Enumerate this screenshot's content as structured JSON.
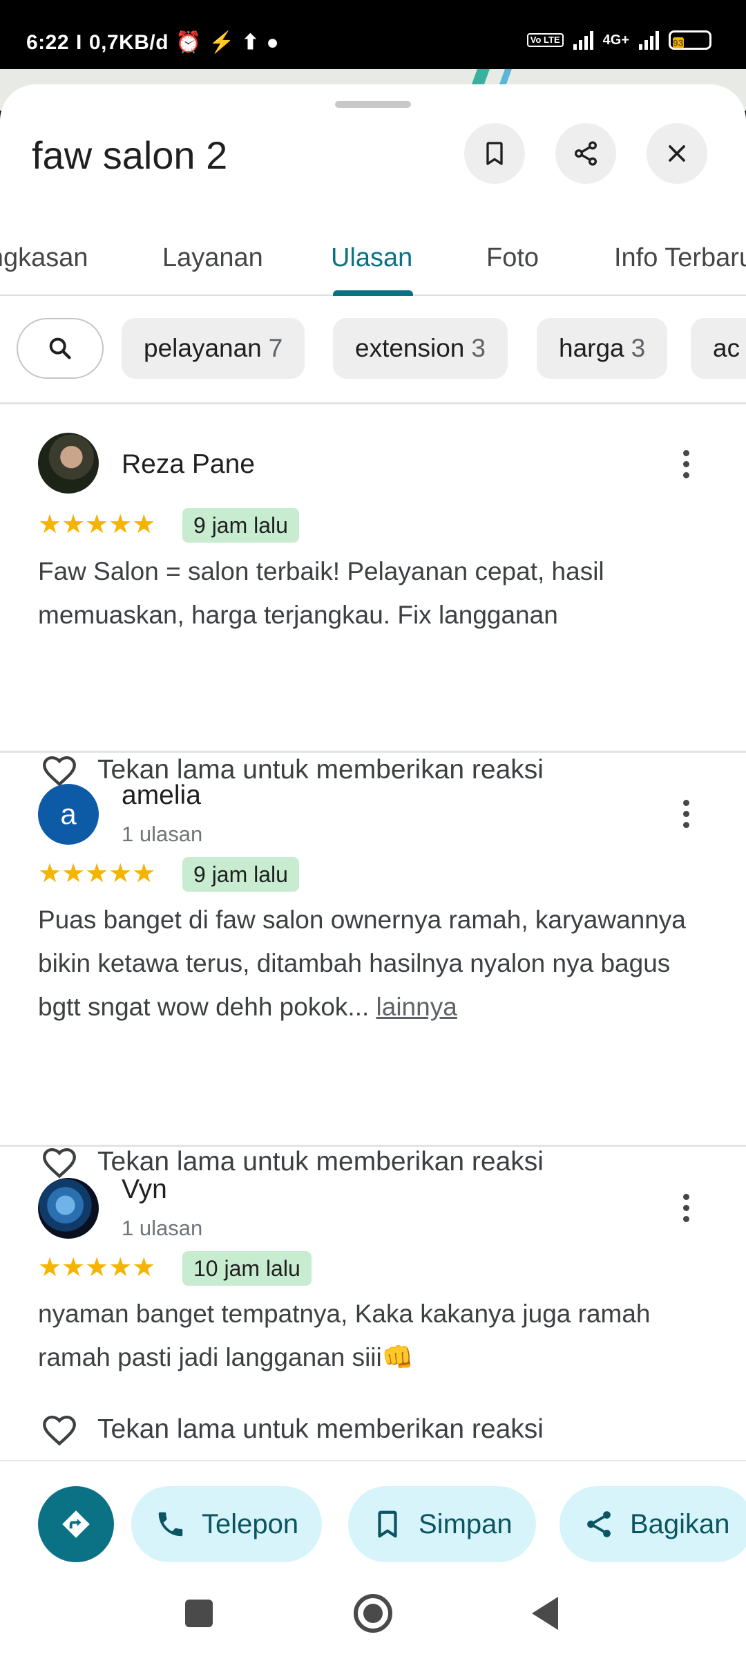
{
  "status_bar": {
    "time": "6:22",
    "separator": "I",
    "net_speed": "0,7KB/d",
    "volte": "Vo LTE",
    "network": "4G+",
    "battery": "93"
  },
  "header": {
    "title": "faw salon 2"
  },
  "tabs": [
    {
      "label": "Ringkasan"
    },
    {
      "label": "Layanan"
    },
    {
      "label": "Ulasan",
      "active": true
    },
    {
      "label": "Foto"
    },
    {
      "label": "Info Terbaru"
    }
  ],
  "chips": [
    {
      "label": "pelayanan",
      "count": "7"
    },
    {
      "label": "extension",
      "count": "3"
    },
    {
      "label": "harga",
      "count": "3"
    },
    {
      "label": "ac",
      "count": ""
    }
  ],
  "reviews": [
    {
      "name": "Reza Pane",
      "subtitle": "",
      "avatar_type": "photo",
      "rating": 5,
      "stars": "★★★★★",
      "time": "9 jam lalu",
      "text": "Faw Salon = salon terbaik! Pelayanan cepat, hasil memuaskan, harga terjangkau. Fix langganan",
      "more": "",
      "react_label": "Tekan lama untuk memberikan reaksi"
    },
    {
      "name": "amelia",
      "subtitle": "1 ulasan",
      "avatar_letter": "a",
      "rating": 5,
      "stars": "★★★★★",
      "time": "9 jam lalu",
      "text": "Puas banget di faw salon ownernya ramah, karyawannya bikin ketawa terus, ditambah hasilnya nyalon nya bagus bgtt sngat wow dehh pokok... ",
      "more": "lainnya",
      "react_label": "Tekan lama untuk memberikan reaksi"
    },
    {
      "name": "Vyn",
      "subtitle": "1 ulasan",
      "avatar_type": "photo",
      "rating": 5,
      "stars": "★★★★★",
      "time": "10 jam lalu",
      "text": "nyaman banget tempatnya, Kaka kakanya juga ramah ramah pasti jadi langganan siii👊",
      "more": "",
      "react_label": "Tekan lama untuk memberikan reaksi"
    }
  ],
  "actions": {
    "call": "Telepon",
    "save": "Simpan",
    "share": "Bagikan"
  },
  "colors": {
    "accent": "#0b7285",
    "star": "#f5b400",
    "badge_bg": "#c8ecd0",
    "action_bg": "#d7f4fb"
  }
}
